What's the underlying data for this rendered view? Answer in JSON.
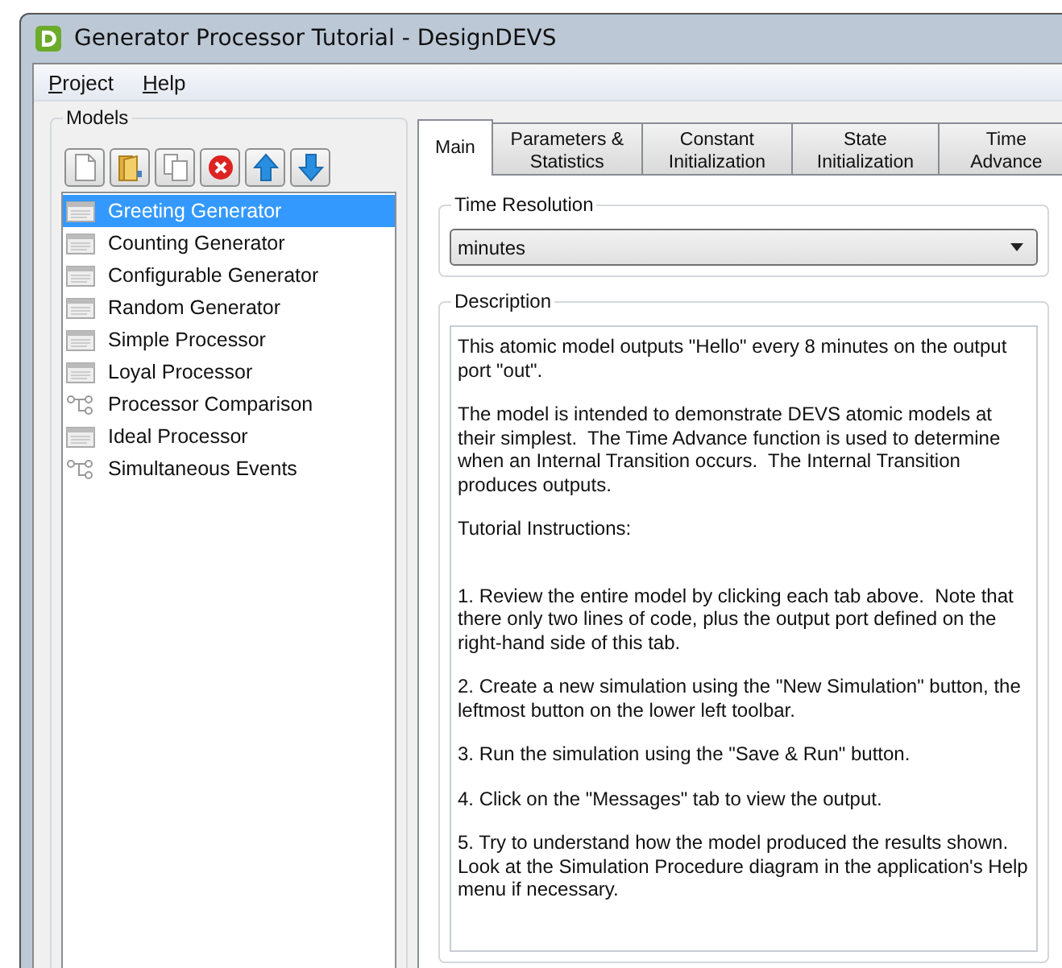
{
  "window": {
    "title": "Generator Processor Tutorial - DesignDEVS"
  },
  "menu": [
    "Project",
    "Help"
  ],
  "models": {
    "title": "Models",
    "toolbar": [
      {
        "kind": "new"
      },
      {
        "kind": "open"
      },
      {
        "kind": "copy"
      },
      {
        "kind": "delete"
      },
      {
        "kind": "up"
      },
      {
        "kind": "down"
      }
    ],
    "items": [
      {
        "label": "Greeting Generator",
        "kind": "atomic",
        "selected": true
      },
      {
        "label": "Counting Generator",
        "kind": "atomic",
        "selected": false
      },
      {
        "label": "Configurable Generator",
        "kind": "atomic",
        "selected": false
      },
      {
        "label": "Random Generator",
        "kind": "atomic",
        "selected": false
      },
      {
        "label": "Simple Processor",
        "kind": "atomic",
        "selected": false
      },
      {
        "label": "Loyal Processor",
        "kind": "atomic",
        "selected": false
      },
      {
        "label": "Processor Comparison",
        "kind": "coupled",
        "selected": false
      },
      {
        "label": "Ideal Processor",
        "kind": "atomic",
        "selected": false
      },
      {
        "label": "Simultaneous Events",
        "kind": "coupled",
        "selected": false
      }
    ]
  },
  "tabs": [
    {
      "label": "Main",
      "selected": true
    },
    {
      "label": "Parameters &\nStatistics",
      "selected": false
    },
    {
      "label": "Constant\nInitialization",
      "selected": false
    },
    {
      "label": "State\nInitialization",
      "selected": false
    },
    {
      "label": "Time\nAdvance",
      "selected": false
    }
  ],
  "time_resolution": {
    "title": "Time Resolution",
    "value": "minutes"
  },
  "description": {
    "title": "Description",
    "paragraphs": [
      "This atomic model outputs \"Hello\" every 8 minutes on the output port \"out\".",
      "The model is intended to demonstrate DEVS atomic models at their simplest.  The Time Advance function is used to determine when an Internal Transition occurs.  The Internal Transition produces outputs.",
      "Tutorial Instructions:"
    ],
    "steps": [
      "1. Review the entire model by clicking each tab above.  Note that there only two lines of code, plus the output port defined on the right-hand side of this tab.",
      "2. Create a new simulation using the \"New Simulation\" button, the leftmost button on the lower left toolbar.",
      "3. Run the simulation using the \"Save & Run\" button.",
      "4. Click on the \"Messages\" tab to view the output.",
      "5. Try to understand how the model produced the results shown.  Look at the Simulation Procedure diagram in the application's Help menu if necessary."
    ]
  }
}
